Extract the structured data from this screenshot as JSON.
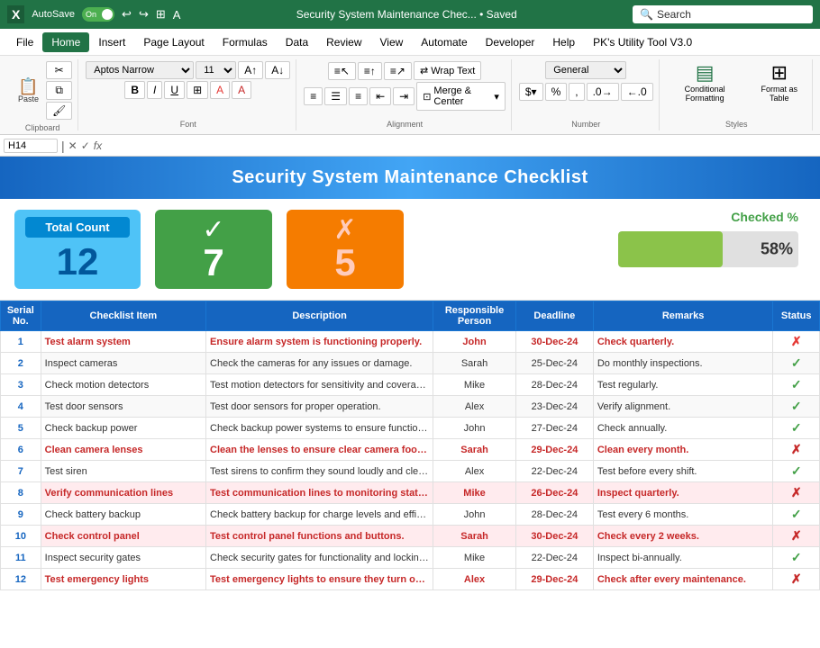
{
  "titlebar": {
    "logo": "X",
    "autosave_label": "AutoSave",
    "toggle_on": "On",
    "title": "Security System Maintenance Chec... • Saved",
    "search_placeholder": "Search"
  },
  "menu": {
    "items": [
      "File",
      "Home",
      "Insert",
      "Page Layout",
      "Formulas",
      "Data",
      "Review",
      "View",
      "Automate",
      "Developer",
      "Help",
      "PK's Utility Tool V3.0"
    ]
  },
  "ribbon": {
    "clipboard_label": "Clipboard",
    "font_label": "Font",
    "alignment_label": "Alignment",
    "number_label": "Number",
    "styles_label": "Styles",
    "font_name": "Aptos Narrow",
    "font_size": "11",
    "wrap_text": "Wrap Text",
    "merge_center": "Merge & Center",
    "number_format": "General",
    "conditional_formatting": "Conditional Formatting",
    "format_as_table": "Format as Table"
  },
  "formula_bar": {
    "cell_ref": "H14",
    "formula": ""
  },
  "spreadsheet": {
    "title": "Security System Maintenance Checklist",
    "kpi": {
      "total_label": "Total Count",
      "total_value": "12",
      "checked_icon": "✓",
      "checked_value": "7",
      "unchecked_icon": "✗",
      "unchecked_value": "5",
      "percent_label": "Checked %",
      "percent_value": "58%",
      "percent_bar": 58
    },
    "headers": [
      "Serial No.",
      "Checklist Item",
      "Description",
      "Responsible Person",
      "Deadline",
      "Remarks",
      "Status"
    ],
    "rows": [
      {
        "num": 1,
        "item": "Test alarm system",
        "desc": "Ensure alarm system is functioning properly.",
        "person": "John",
        "deadline": "30-Dec-24",
        "remarks": "Check quarterly.",
        "status": "✗",
        "highlight": true
      },
      {
        "num": 2,
        "item": "Inspect cameras",
        "desc": "Check the cameras for any issues or damage.",
        "person": "Sarah",
        "deadline": "25-Dec-24",
        "remarks": "Do monthly inspections.",
        "status": "✓",
        "highlight": false
      },
      {
        "num": 3,
        "item": "Check motion detectors",
        "desc": "Test motion detectors for sensitivity and coverage.",
        "person": "Mike",
        "deadline": "28-Dec-24",
        "remarks": "Test regularly.",
        "status": "✓",
        "highlight": false
      },
      {
        "num": 4,
        "item": "Test door sensors",
        "desc": "Test door sensors for proper operation.",
        "person": "Alex",
        "deadline": "23-Dec-24",
        "remarks": "Verify alignment.",
        "status": "✓",
        "highlight": false
      },
      {
        "num": 5,
        "item": "Check backup power",
        "desc": "Check backup power systems to ensure functionality.",
        "person": "John",
        "deadline": "27-Dec-24",
        "remarks": "Check annually.",
        "status": "✓",
        "highlight": false
      },
      {
        "num": 6,
        "item": "Clean camera lenses",
        "desc": "Clean the lenses to ensure clear camera footage.",
        "person": "Sarah",
        "deadline": "29-Dec-24",
        "remarks": "Clean every month.",
        "status": "✗",
        "highlight": true
      },
      {
        "num": 7,
        "item": "Test siren",
        "desc": "Test sirens to confirm they sound loudly and clearly.",
        "person": "Alex",
        "deadline": "22-Dec-24",
        "remarks": "Test before every shift.",
        "status": "✓",
        "highlight": false
      },
      {
        "num": 8,
        "item": "Verify communication lines",
        "desc": "Test communication lines to monitoring stations and.",
        "person": "Mike",
        "deadline": "26-Dec-24",
        "remarks": "Inspect quarterly.",
        "status": "✗",
        "highlight": true
      },
      {
        "num": 9,
        "item": "Check battery backup",
        "desc": "Check battery backup for charge levels and efficiency.",
        "person": "John",
        "deadline": "28-Dec-24",
        "remarks": "Test every 6 months.",
        "status": "✓",
        "highlight": false
      },
      {
        "num": 10,
        "item": "Check control panel",
        "desc": "Test control panel functions and buttons.",
        "person": "Sarah",
        "deadline": "30-Dec-24",
        "remarks": "Check every 2 weeks.",
        "status": "✗",
        "highlight": true
      },
      {
        "num": 11,
        "item": "Inspect security gates",
        "desc": "Check security gates for functionality and locking mech.",
        "person": "Mike",
        "deadline": "22-Dec-24",
        "remarks": "Inspect bi-annually.",
        "status": "✓",
        "highlight": false
      },
      {
        "num": 12,
        "item": "Test emergency lights",
        "desc": "Test emergency lights to ensure they turn on properly.",
        "person": "Alex",
        "deadline": "29-Dec-24",
        "remarks": "Check after every maintenance.",
        "status": "✗",
        "highlight": true
      }
    ]
  }
}
